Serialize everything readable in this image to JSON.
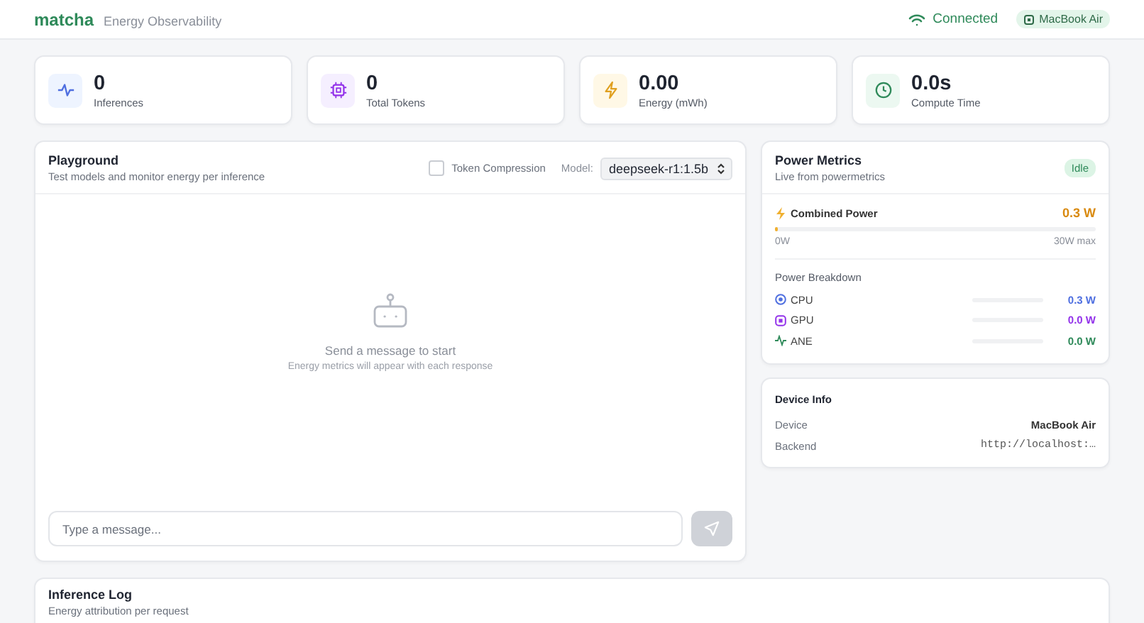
{
  "header": {
    "logo": "matcha",
    "subtitle": "Energy Observability",
    "connection": {
      "label": "Connected",
      "on": true
    },
    "device_badge": "MacBook Air"
  },
  "stats": [
    {
      "kind": "activity",
      "value": "0",
      "label": "Inferences"
    },
    {
      "kind": "chip",
      "value": "0",
      "label": "Total Tokens"
    },
    {
      "kind": "bolt",
      "value": "0.00",
      "label": "Energy (mWh)"
    },
    {
      "kind": "clock",
      "value": "0.0s",
      "label": "Compute Time"
    }
  ],
  "playground": {
    "title": "Playground",
    "subtitle": "Test models and monitor energy per inference",
    "token_compression": {
      "label": "Token Compression",
      "checked": false
    },
    "model_label": "Model:",
    "model": "deepseek-r1:1.5b",
    "empty_title": "Send a message to start",
    "empty_subtitle": "Energy metrics will appear with each response",
    "input": {
      "placeholder": "Type a message..."
    },
    "send_disabled": true
  },
  "power_metrics": {
    "title": "Power Metrics",
    "subtitle": "Live from powermetrics",
    "status": "Idle",
    "combined": {
      "label": "Combined Power",
      "value": "0.3 W",
      "level": 0.01,
      "min_label": "0W",
      "max_label": "30W max"
    },
    "breakdown_title": "Power Breakdown",
    "breakdown": [
      {
        "kind": "cpu",
        "label": "CPU",
        "value": "0.3 W",
        "level": 0,
        "color": "#4f6fe0"
      },
      {
        "kind": "gpu",
        "label": "GPU",
        "value": "0.0 W",
        "level": 0,
        "color": "#9333ea"
      },
      {
        "kind": "ane",
        "label": "ANE",
        "value": "0.0 W",
        "level": 0,
        "color": "#2f8a5a"
      }
    ]
  },
  "device_info": {
    "title": "Device Info",
    "rows": [
      {
        "label": "Device",
        "value": "MacBook Air",
        "kind": "text"
      },
      {
        "label": "Backend",
        "value": "http://localhost:…",
        "kind": "mono"
      }
    ]
  },
  "inference_log": {
    "title": "Inference Log",
    "subtitle": "Energy attribution per request"
  }
}
